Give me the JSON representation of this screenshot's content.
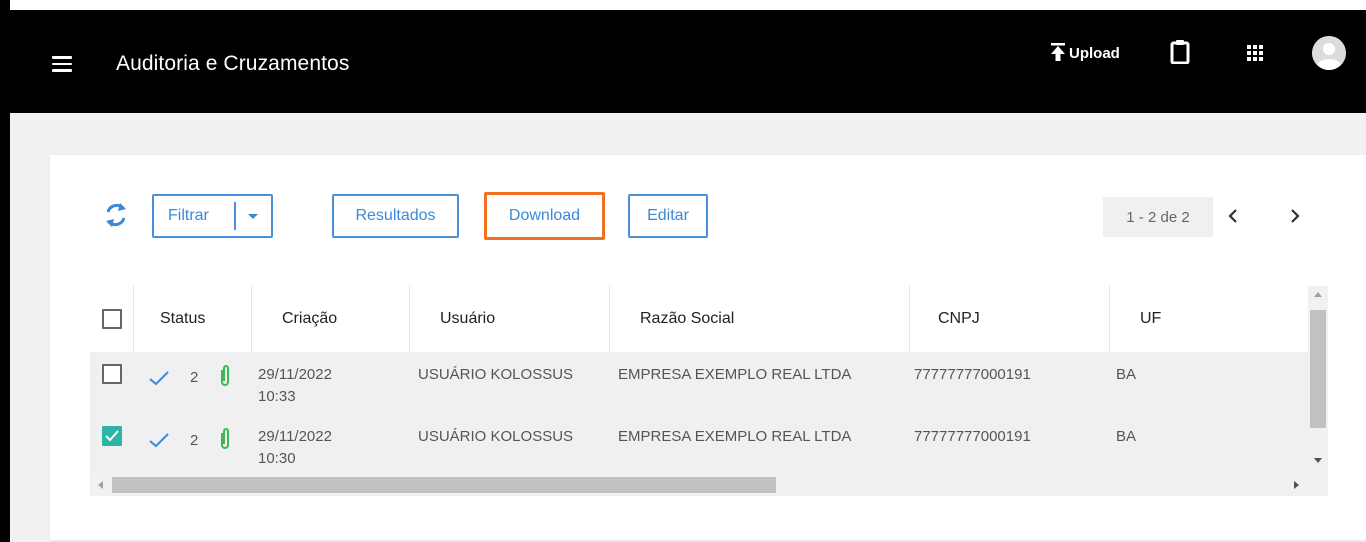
{
  "app": {
    "title": "Auditoria e Cruzamentos"
  },
  "header": {
    "upload_label": "Upload"
  },
  "toolbar": {
    "filter_label": "Filtrar",
    "results_label": "Resultados",
    "download_label": "Download",
    "edit_label": "Editar"
  },
  "pagination": {
    "text": "1 - 2 de 2"
  },
  "table": {
    "columns": [
      "Status",
      "Criação",
      "Usuário",
      "Razão Social",
      "CNPJ",
      "UF"
    ],
    "rows": [
      {
        "checked": false,
        "status_count": "2",
        "creation_date": "29/11/2022",
        "creation_time": "10:33",
        "user": "USUÁRIO KOLOSSUS",
        "company": "EMPRESA EXEMPLO REAL LTDA",
        "cnpj": "77777777000191",
        "uf": "BA"
      },
      {
        "checked": true,
        "status_count": "2",
        "creation_date": "29/11/2022",
        "creation_time": "10:30",
        "user": "USUÁRIO KOLOSSUS",
        "company": "EMPRESA EXEMPLO REAL LTDA",
        "cnpj": "77777777000191",
        "uf": "BA"
      }
    ]
  },
  "colors": {
    "accent": "#4a90d9",
    "highlight": "#f07020",
    "check": "#2bb5a6",
    "attach": "#3cb85a"
  },
  "icons": [
    "menu-icon",
    "upload-icon",
    "clipboard-icon",
    "apps-icon",
    "avatar-icon",
    "refresh-icon",
    "checkmark-icon",
    "paperclip-icon",
    "chevron-left-icon",
    "chevron-right-icon"
  ]
}
